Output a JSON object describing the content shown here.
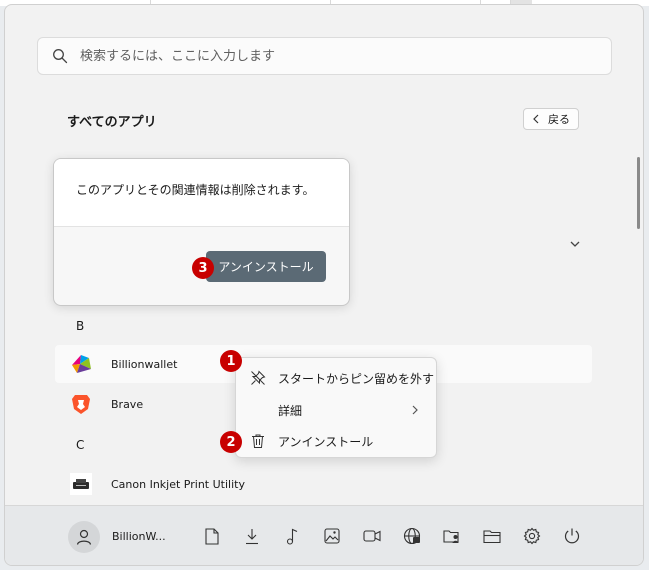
{
  "search": {
    "placeholder": "検索するには、ここに入力します",
    "icon": "search-icon"
  },
  "all_apps": {
    "title": "すべてのアプリ",
    "back_label": "戻る"
  },
  "dialog": {
    "message": "このアプリとその関連情報は削除されます。",
    "uninstall_button": "アンインストール"
  },
  "badges": [
    "1",
    "2",
    "3"
  ],
  "app_list": {
    "groups": [
      {
        "letter": "B",
        "apps": [
          {
            "name": "Billionwallet",
            "icon": "billionwallet-app-icon"
          },
          {
            "name": "Brave",
            "icon": "brave-app-icon"
          }
        ]
      },
      {
        "letter": "C",
        "apps": [
          {
            "name": "Canon Inkjet Print Utility",
            "icon": "printer-app-icon"
          }
        ]
      }
    ]
  },
  "context_menu": {
    "items": [
      {
        "label": "スタートからピン留めを外す",
        "icon": "unpin-icon"
      },
      {
        "label": "詳細",
        "icon": "",
        "has_submenu": true
      },
      {
        "label": "アンインストール",
        "icon": "trash-icon"
      }
    ]
  },
  "taskbar": {
    "user_name": "BillionW...",
    "icons": [
      "document-icon",
      "download-icon",
      "music-icon",
      "pictures-icon",
      "video-icon",
      "network-icon",
      "personal-folder-icon",
      "file-explorer-icon",
      "settings-icon",
      "power-icon"
    ]
  },
  "colors": {
    "badge": "#c80000",
    "uninstall_button_bg": "#5b6a75",
    "panel_bg": "#f2f2f2",
    "brave_orange": "#fb542b"
  }
}
